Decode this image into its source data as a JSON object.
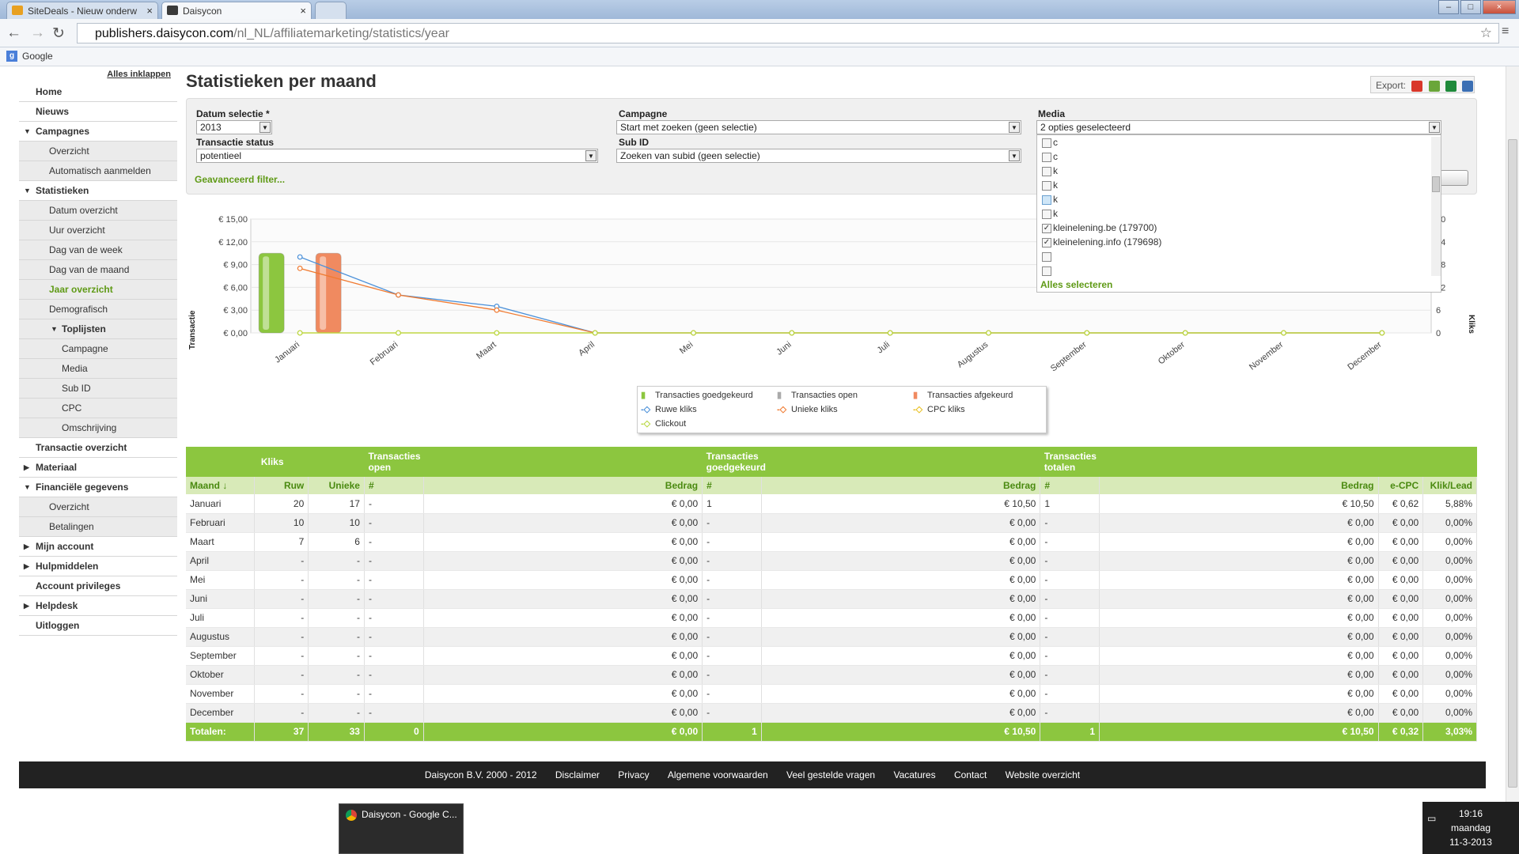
{
  "browser": {
    "tabs": [
      {
        "label": "SiteDeals - Nieuw onderw"
      },
      {
        "label": "Daisycon"
      }
    ],
    "url_domain": "publishers.daisycon.com",
    "url_path": "/nl_NL/affiliatemarketing/statistics/year",
    "bookmark": "Google"
  },
  "sidebar": {
    "collapse_label": "Alles inklappen",
    "items": [
      {
        "label": "Home"
      },
      {
        "label": "Nieuws"
      },
      {
        "label": "Campagnes"
      },
      {
        "label": "Overzicht"
      },
      {
        "label": "Automatisch aanmelden"
      },
      {
        "label": "Statistieken"
      },
      {
        "label": "Datum overzicht"
      },
      {
        "label": "Uur overzicht"
      },
      {
        "label": "Dag van de week"
      },
      {
        "label": "Dag van de maand"
      },
      {
        "label": "Jaar overzicht"
      },
      {
        "label": "Demografisch"
      },
      {
        "label": "Toplijsten"
      },
      {
        "label": "Campagne"
      },
      {
        "label": "Media"
      },
      {
        "label": "Sub ID"
      },
      {
        "label": "CPC"
      },
      {
        "label": "Omschrijving"
      },
      {
        "label": "Transactie overzicht"
      },
      {
        "label": "Materiaal"
      },
      {
        "label": "Financiële gegevens"
      },
      {
        "label": "Overzicht"
      },
      {
        "label": "Betalingen"
      },
      {
        "label": "Mijn account"
      },
      {
        "label": "Hulpmiddelen"
      },
      {
        "label": "Account privileges"
      },
      {
        "label": "Helpdesk"
      },
      {
        "label": "Uitloggen"
      }
    ]
  },
  "page": {
    "title": "Statistieken per maand",
    "export_label": "Export:"
  },
  "filters": {
    "datum_label": "Datum selectie *",
    "datum_value": "2013",
    "campagne_label": "Campagne",
    "campagne_value": "Start met zoeken (geen selectie)",
    "media_label": "Media",
    "media_value": "2 opties geselecteerd",
    "status_label": "Transactie status",
    "status_value": "potentieel",
    "subid_label": "Sub ID",
    "subid_value": "Zoeken van subid (geen selectie)",
    "advanced": "Geavanceerd filter...",
    "media_options": [
      {
        "label": "c",
        "checked": false
      },
      {
        "label": "c",
        "checked": false
      },
      {
        "label": "k",
        "checked": false
      },
      {
        "label": "k",
        "checked": false
      },
      {
        "label": "k",
        "checked": false
      },
      {
        "label": "k",
        "checked": false
      },
      {
        "label": "kleinelening.be (179700)",
        "checked": true
      },
      {
        "label": "kleinelening.info (179698)",
        "checked": true
      },
      {
        "label": "",
        "checked": false
      },
      {
        "label": "",
        "checked": false
      }
    ],
    "select_all": "Alles selecteren"
  },
  "chart_data": {
    "type": "bar",
    "categories": [
      "Januari",
      "Februari",
      "Maart",
      "April",
      "Mei",
      "Juni",
      "Juli",
      "Augustus",
      "September",
      "Oktober",
      "November",
      "December"
    ],
    "ylabel": "Transactie",
    "y2label": "Kliks",
    "ylim": [
      0,
      15
    ],
    "y2lim": [
      0,
      30
    ],
    "yticks": [
      "€ 0,00",
      "€ 3,00",
      "€ 6,00",
      "€ 9,00",
      "€ 12,00",
      "€ 15,00"
    ],
    "y2ticks": [
      "0",
      "6",
      "12",
      "18",
      "24",
      "30"
    ],
    "bar_series": [
      {
        "name": "Transacties goedgekeurd",
        "values": [
          10.5,
          0,
          0,
          0,
          0,
          0,
          0,
          0,
          0,
          0,
          0,
          0
        ],
        "color": "#8cc63f"
      },
      {
        "name": "Transacties open",
        "values": [
          0,
          0,
          0,
          0,
          0,
          0,
          0,
          0,
          0,
          0,
          0,
          0
        ],
        "color": "#aaaaaa"
      },
      {
        "name": "Transacties afgekeurd",
        "values": [
          10.5,
          0,
          0,
          0,
          0,
          0,
          0,
          0,
          0,
          0,
          0,
          0
        ],
        "color": "#f08a60"
      }
    ],
    "line_series": [
      {
        "name": "Ruwe kliks",
        "values": [
          20,
          10,
          7,
          0,
          0,
          0,
          0,
          0,
          0,
          0,
          0,
          0
        ],
        "color": "#4a90d9"
      },
      {
        "name": "Unieke kliks",
        "values": [
          17,
          10,
          6,
          0,
          0,
          0,
          0,
          0,
          0,
          0,
          0,
          0
        ],
        "color": "#f07a30"
      },
      {
        "name": "CPC kliks",
        "values": [
          0,
          0,
          0,
          0,
          0,
          0,
          0,
          0,
          0,
          0,
          0,
          0
        ],
        "color": "#e8c020"
      },
      {
        "name": "Clickout",
        "values": [
          0,
          0,
          0,
          0,
          0,
          0,
          0,
          0,
          0,
          0,
          0,
          0
        ],
        "color": "#b8d840"
      }
    ]
  },
  "table": {
    "group_headers": [
      "Kliks",
      "Transacties open",
      "Transacties goedgekeurd",
      "Transacties totalen"
    ],
    "columns": [
      "Maand ↓",
      "Ruw",
      "Unieke",
      "#",
      "Bedrag",
      "#",
      "Bedrag",
      "#",
      "Bedrag",
      "e-CPC",
      "Klik/Lead"
    ],
    "rows": [
      [
        "Januari",
        "20",
        "17",
        "-",
        "€ 0,00",
        "1",
        "€ 10,50",
        "1",
        "€ 10,50",
        "€ 0,62",
        "5,88%"
      ],
      [
        "Februari",
        "10",
        "10",
        "-",
        "€ 0,00",
        "-",
        "€ 0,00",
        "-",
        "€ 0,00",
        "€ 0,00",
        "0,00%"
      ],
      [
        "Maart",
        "7",
        "6",
        "-",
        "€ 0,00",
        "-",
        "€ 0,00",
        "-",
        "€ 0,00",
        "€ 0,00",
        "0,00%"
      ],
      [
        "April",
        "-",
        "-",
        "-",
        "€ 0,00",
        "-",
        "€ 0,00",
        "-",
        "€ 0,00",
        "€ 0,00",
        "0,00%"
      ],
      [
        "Mei",
        "-",
        "-",
        "-",
        "€ 0,00",
        "-",
        "€ 0,00",
        "-",
        "€ 0,00",
        "€ 0,00",
        "0,00%"
      ],
      [
        "Juni",
        "-",
        "-",
        "-",
        "€ 0,00",
        "-",
        "€ 0,00",
        "-",
        "€ 0,00",
        "€ 0,00",
        "0,00%"
      ],
      [
        "Juli",
        "-",
        "-",
        "-",
        "€ 0,00",
        "-",
        "€ 0,00",
        "-",
        "€ 0,00",
        "€ 0,00",
        "0,00%"
      ],
      [
        "Augustus",
        "-",
        "-",
        "-",
        "€ 0,00",
        "-",
        "€ 0,00",
        "-",
        "€ 0,00",
        "€ 0,00",
        "0,00%"
      ],
      [
        "September",
        "-",
        "-",
        "-",
        "€ 0,00",
        "-",
        "€ 0,00",
        "-",
        "€ 0,00",
        "€ 0,00",
        "0,00%"
      ],
      [
        "Oktober",
        "-",
        "-",
        "-",
        "€ 0,00",
        "-",
        "€ 0,00",
        "-",
        "€ 0,00",
        "€ 0,00",
        "0,00%"
      ],
      [
        "November",
        "-",
        "-",
        "-",
        "€ 0,00",
        "-",
        "€ 0,00",
        "-",
        "€ 0,00",
        "€ 0,00",
        "0,00%"
      ],
      [
        "December",
        "-",
        "-",
        "-",
        "€ 0,00",
        "-",
        "€ 0,00",
        "-",
        "€ 0,00",
        "€ 0,00",
        "0,00%"
      ]
    ],
    "totals": [
      "Totalen:",
      "37",
      "33",
      "0",
      "€ 0,00",
      "1",
      "€ 10,50",
      "1",
      "€ 10,50",
      "€ 0,32",
      "3,03%"
    ]
  },
  "footer": [
    "Daisycon B.V. 2000 - 2012",
    "Disclaimer",
    "Privacy",
    "Algemene voorwaarden",
    "Veel gestelde vragen",
    "Vacatures",
    "Contact",
    "Website overzicht"
  ],
  "taskbar": {
    "item": "Daisycon - Google C...",
    "time": "19:16",
    "day": "maandag",
    "date": "11-3-2013"
  },
  "colors": {
    "accent": "#8cc63f",
    "accent_text": "#5f9a16"
  }
}
